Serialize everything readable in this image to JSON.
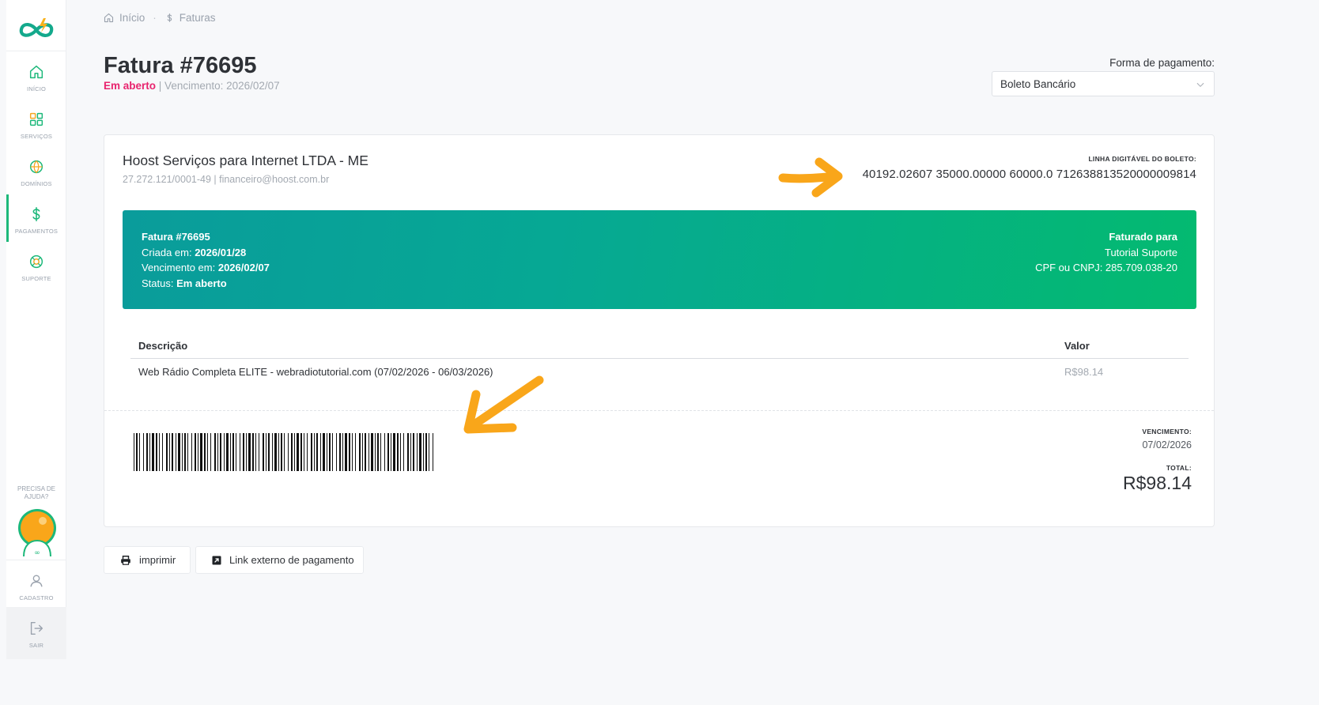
{
  "sidebar": {
    "items": [
      {
        "label": "INÍCIO",
        "icon": "home-icon"
      },
      {
        "label": "SERVIÇOS",
        "icon": "grid-icon"
      },
      {
        "label": "DOMÍNIOS",
        "icon": "globe-icon"
      },
      {
        "label": "PAGAMENTOS",
        "icon": "dollar-icon"
      },
      {
        "label": "SUPORTE",
        "icon": "lifebuoy-icon"
      }
    ],
    "help_line1": "PRECISA DE",
    "help_line2": "AJUDA?",
    "cadastro": "CADASTRO",
    "sair": "SAIR",
    "accent": "#1cb87a"
  },
  "breadcrumb": {
    "home": "Início",
    "separator": "·",
    "current": "Faturas"
  },
  "header": {
    "title": "Fatura #76695",
    "status": "Em aberto",
    "due_text": "| Vencimento: 2026/02/07"
  },
  "payment": {
    "label": "Forma de pagamento:",
    "selected": "Boleto Bancário"
  },
  "invoice": {
    "company": "Hoost Serviços para Internet LTDA - ME",
    "company_info": "27.272.121/0001-49 | financeiro@hoost.com.br",
    "boleto_label": "LINHA DIGITÁVEL DO BOLETO:",
    "boleto_line": "40192.02607 35000.00000 60000.0 7126388135200000098​14",
    "banner": {
      "invoice_no": "Fatura #76695",
      "created_label": "Criada em:",
      "created_value": "2026/01/28",
      "due_label": "Vencimento em:",
      "due_value": "2026/02/07",
      "status_label": "Status:",
      "status_value": "Em aberto",
      "billed_to_label": "Faturado para",
      "billed_to_name": "Tutorial Suporte",
      "cpf": "CPF ou CNPJ: 285.709.038-20"
    },
    "table": {
      "headers": [
        "Descrição",
        "Valor"
      ],
      "rows": [
        {
          "description": "Web Rádio Completa ELITE - webradiotutorial.com (07/02/2026 - 06/03/2026)",
          "value": "R$98.14"
        }
      ]
    },
    "vencimento_label": "VENCIMENTO:",
    "vencimento_value": "07/02/2026",
    "total_label": "TOTAL:",
    "total_value": "R$98.14"
  },
  "buttons": {
    "print": "imprimir",
    "external_link": "Link externo de pagamento"
  },
  "colors": {
    "status_open": "#e8246e",
    "banner_start": "#0a9c9b",
    "banner_end": "#04ba70",
    "annotation_arrow": "#f9a61a"
  }
}
